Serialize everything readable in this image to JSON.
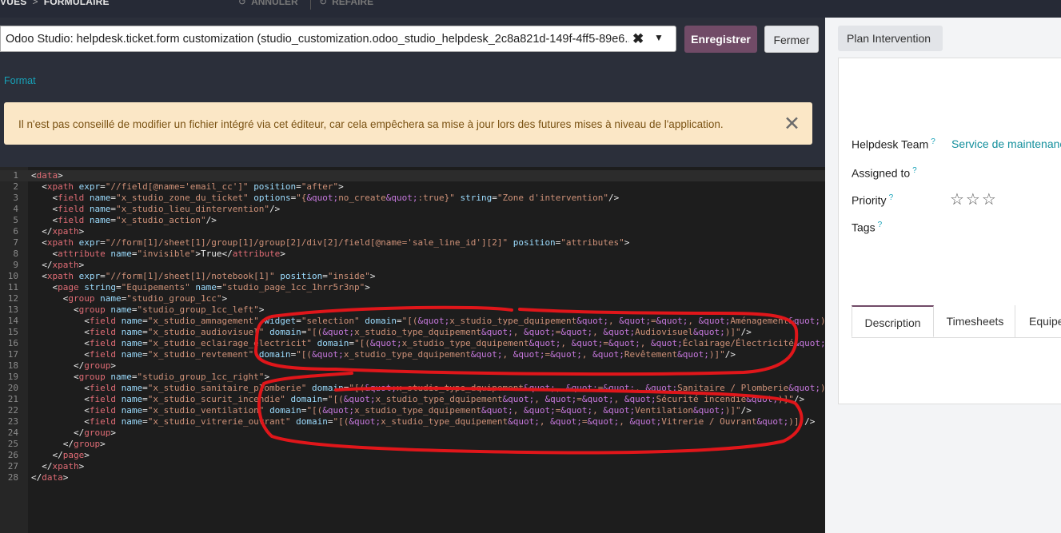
{
  "breadcrumb": {
    "parent": "VUES",
    "separator": ">",
    "current": "FORMULAIRE"
  },
  "toolbar": {
    "undo_label": "ANNULER",
    "redo_label": "REFAIRE",
    "undo_icon": "↺",
    "redo_icon": "↻"
  },
  "view_selector": {
    "value": "Odoo Studio: helpdesk.ticket.form customization (studio_customization.odoo_studio_helpdesk_2c8a821d-149f-4ff5-89e6...",
    "clear": "✖",
    "caret": "▼"
  },
  "buttons": {
    "save": "Enregistrer",
    "close": "Fermer"
  },
  "format_link": "Format",
  "warning": {
    "message": "Il n'est pas conseillé de modifier un fichier intégré via cet éditeur, car cela empêchera sa mise à jour lors des futures mises à niveau de l'application.",
    "close": "✕"
  },
  "code": [
    "<data>",
    "  <xpath expr=\"//field[@name='email_cc']\" position=\"after\">",
    "    <field name=\"x_studio_zone_du_ticket\" options=\"{&quot;no_create&quot;:true}\" string=\"Zone d'intervention\"/>",
    "    <field name=\"x_studio_lieu_dintervention\"/>",
    "    <field name=\"x_studio_action\"/>",
    "  </xpath>",
    "  <xpath expr=\"//form[1]/sheet[1]/group[1]/group[2]/div[2]/field[@name='sale_line_id'][2]\" position=\"attributes\">",
    "    <attribute name=\"invisible\">True</attribute>",
    "  </xpath>",
    "  <xpath expr=\"//form[1]/sheet[1]/notebook[1]\" position=\"inside\">",
    "    <page string=\"Equipements\" name=\"studio_page_1cc_1hrr5r3np\">",
    "      <group name=\"studio_group_1cc\">",
    "        <group name=\"studio_group_1cc_left\">",
    "          <field name=\"x_studio_amnagement\" widget=\"selection\" domain=\"[(&quot;x_studio_type_dquipement&quot;, &quot;=&quot;, &quot;Aménagement&quot;)]\"/>",
    "          <field name=\"x_studio_audiovisuel\" domain=\"[(&quot;x_studio_type_dquipement&quot;, &quot;=&quot;, &quot;Audiovisuel&quot;)]\"/>",
    "          <field name=\"x_studio_eclairage_electricit\" domain=\"[(&quot;x_studio_type_dquipement&quot;, &quot;=&quot;, &quot;Éclairage/Électricité&quot;)]\"/>",
    "          <field name=\"x_studio_revtement\" domain=\"[(&quot;x_studio_type_dquipement&quot;, &quot;=&quot;, &quot;Revêtement&quot;)]\"/>",
    "        </group>",
    "        <group name=\"studio_group_1cc_right\">",
    "          <field name=\"x_studio_sanitaire_plomberie\" domain=\"[(&quot;x_studio_type_dquipement&quot;, &quot;=&quot;, &quot;Sanitaire / Plomberie&quot;)]\"/>",
    "          <field name=\"x_studio_scurit_incendie\" domain=\"[(&quot;x_studio_type_dquipement&quot;, &quot;=&quot;, &quot;Sécurité incendie&quot;)]\"/>",
    "          <field name=\"x_studio_ventilation\" domain=\"[(&quot;x_studio_type_dquipement&quot;, &quot;=&quot;, &quot;Ventilation&quot;)]\"/>",
    "          <field name=\"x_studio_vitrerie_ouvrant\" domain=\"[(&quot;x_studio_type_dquipement&quot;, &quot;=&quot;, &quot;Vitrerie / Ouvrant&quot;)]\"/>",
    "        </group>",
    "      </group>",
    "    </page>",
    "  </xpath>",
    "</data>"
  ],
  "preview": {
    "plan_button": "Plan Intervention",
    "help_marker": "?",
    "fields": {
      "helpdesk_team": "Helpdesk Team",
      "helpdesk_team_value": "Service de maintenanc",
      "assigned_to": "Assigned to",
      "priority": "Priority",
      "priority_stars": "☆☆☆",
      "tags": "Tags"
    },
    "tabs": [
      "Description",
      "Timesheets",
      "Equipe"
    ]
  },
  "annotation_color": "#e0161a"
}
